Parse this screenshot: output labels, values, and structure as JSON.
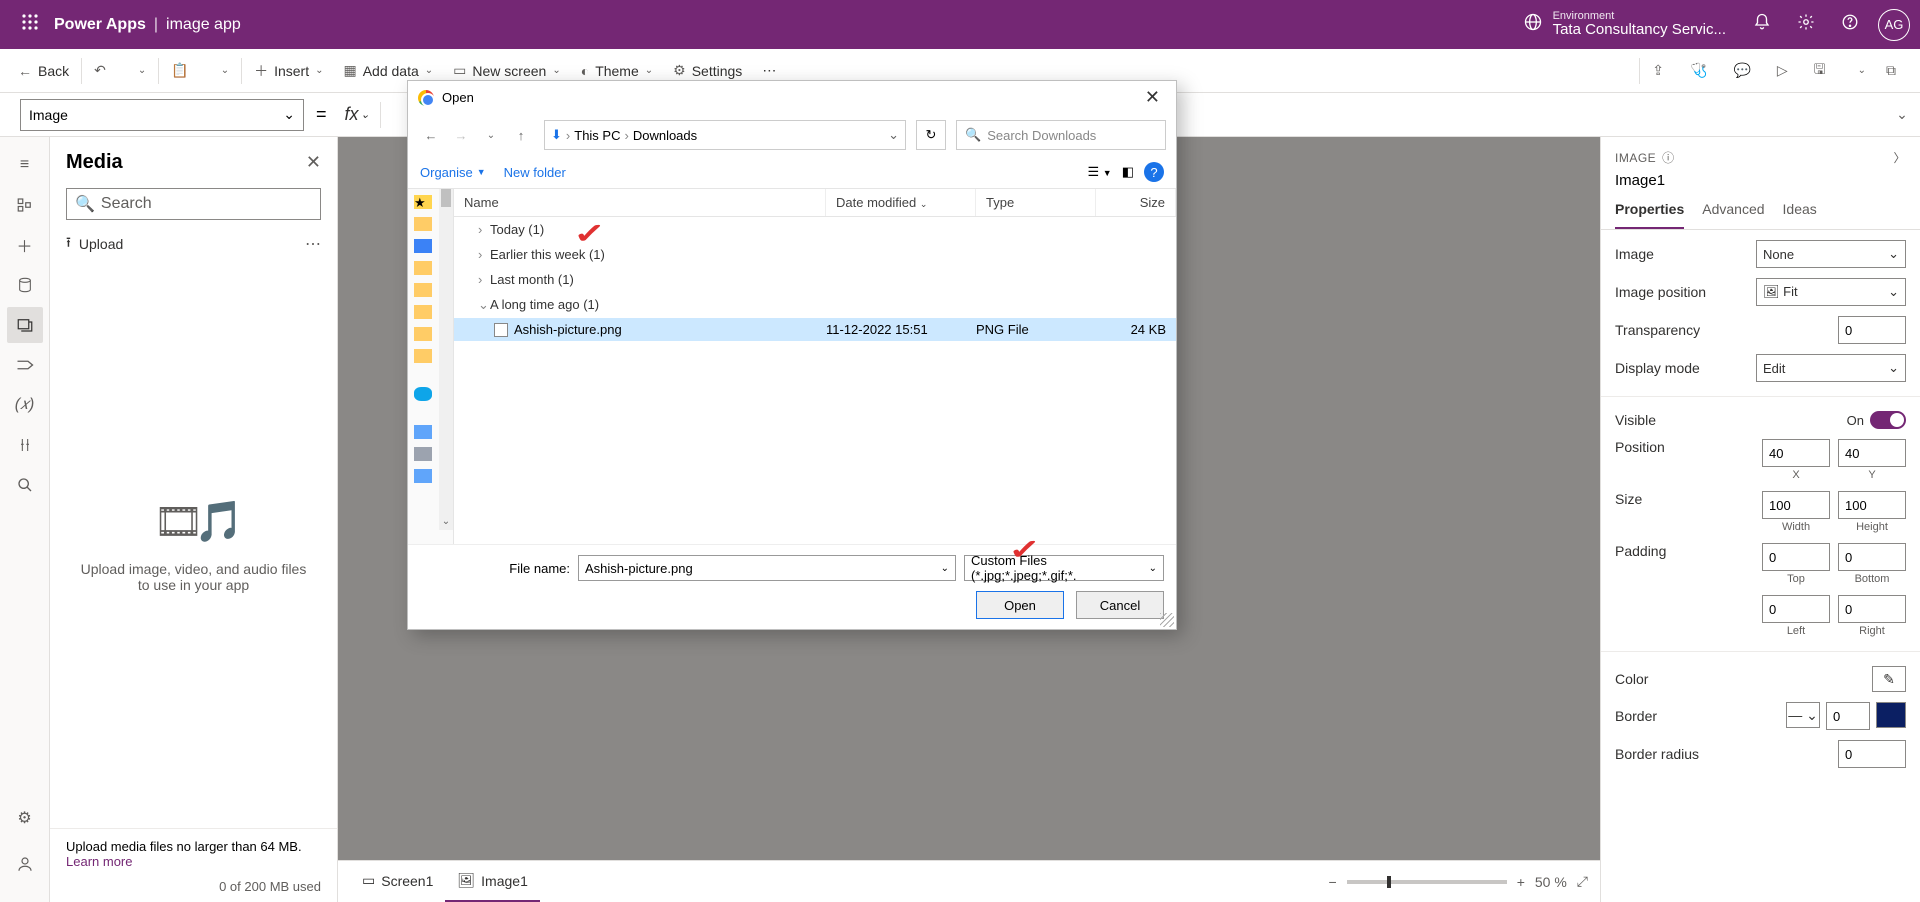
{
  "header": {
    "product": "Power Apps",
    "separator": "|",
    "app_name": "image app",
    "env_label": "Environment",
    "env_name": "Tata Consultancy Servic...",
    "avatar_initials": "AG"
  },
  "cmdbar": {
    "back": "Back",
    "insert": "Insert",
    "add_data": "Add data",
    "new_screen": "New screen",
    "theme": "Theme",
    "settings": "Settings"
  },
  "formula": {
    "property": "Image",
    "eq": "=",
    "fx_chev": "⌄"
  },
  "media": {
    "title": "Media",
    "search_placeholder": "Search",
    "upload": "Upload",
    "center_msg": "Upload image, video, and audio files to use in your app",
    "foot_msg": "Upload media files no larger than 64 MB.",
    "learn_more": "Learn more",
    "storage": "0 of 200 MB used"
  },
  "canvas": {
    "tab_screen": "Screen1",
    "tab_image": "Image1",
    "zoom": "50  %"
  },
  "props": {
    "type": "IMAGE",
    "name": "Image1",
    "tabs": {
      "properties": "Properties",
      "advanced": "Advanced",
      "ideas": "Ideas"
    },
    "fields": {
      "image_label": "Image",
      "image_value": "None",
      "position_label": "Image position",
      "position_value": "Fit",
      "transparency_label": "Transparency",
      "transparency_value": "0",
      "display_mode_label": "Display mode",
      "display_mode_value": "Edit",
      "visible_label": "Visible",
      "visible_on": "On",
      "position_row_label": "Position",
      "pos_x": "40",
      "pos_y": "40",
      "pos_x_sub": "X",
      "pos_y_sub": "Y",
      "size_label": "Size",
      "width": "100",
      "height": "100",
      "w_sub": "Width",
      "h_sub": "Height",
      "padding_label": "Padding",
      "pad_top": "0",
      "pad_bottom": "0",
      "pad_left": "0",
      "pad_right": "0",
      "pad_top_sub": "Top",
      "pad_bottom_sub": "Bottom",
      "pad_left_sub": "Left",
      "pad_right_sub": "Right",
      "color_label": "Color",
      "border_label": "Border",
      "border_value": "0",
      "border_radius_label": "Border radius",
      "border_radius_value": "0"
    }
  },
  "dialog": {
    "title": "Open",
    "crumb_pc": "This PC",
    "crumb_dl": "Downloads",
    "search_placeholder": "Search Downloads",
    "organise": "Organise",
    "new_folder": "New folder",
    "cols": {
      "name": "Name",
      "date": "Date modified",
      "type": "Type",
      "size": "Size"
    },
    "groups": {
      "today": "Today (1)",
      "earlier": "Earlier this week (1)",
      "lastmonth": "Last month (1)",
      "longago": "A long time ago (1)"
    },
    "file": {
      "name": "Ashish-picture.png",
      "date": "11-12-2022 15:51",
      "type": "PNG File",
      "size": "24 KB"
    },
    "filename_label": "File name:",
    "filename_value": "Ashish-picture.png",
    "filetype": "Custom Files (*.jpg;*.jpeg;*.gif;*.",
    "open_btn": "Open",
    "cancel_btn": "Cancel"
  }
}
